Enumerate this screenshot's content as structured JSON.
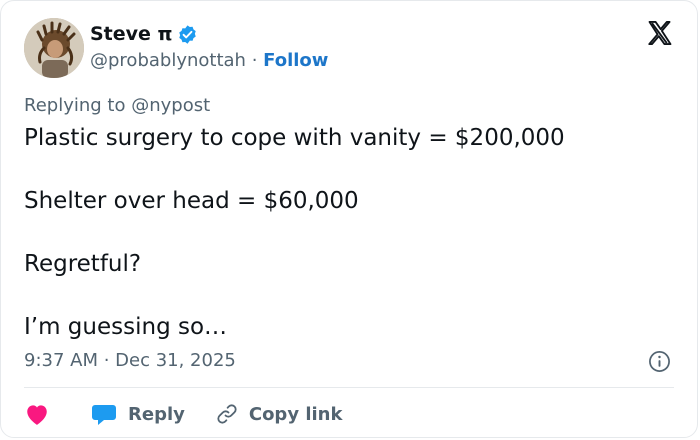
{
  "author": {
    "display_name": "Steve π",
    "handle": "@probablynottah",
    "separator": "·",
    "follow_label": "Follow",
    "verified": true
  },
  "reply_context": {
    "prefix": "Replying to",
    "mention": "@nypost"
  },
  "tweet": {
    "lines": [
      "Plastic surgery to cope with vanity = $200,000",
      "Shelter over head = $60,000",
      "Regretful?",
      "I’m guessing so…"
    ],
    "timestamp": "9:37 AM · Dec 31, 2025"
  },
  "actions": {
    "like_icon": "heart-icon",
    "reply_label": "Reply",
    "copy_link_label": "Copy link"
  },
  "colors": {
    "text": "#0f1419",
    "secondary": "#536471",
    "link": "#1d76c9",
    "verified": "#1d9bf0",
    "heart": "#f91880",
    "reply_bubble": "#1d9bf0",
    "divider": "#e6e9ec"
  },
  "icons": {
    "brand": "x-logo-icon",
    "info": "info-icon",
    "verified": "verified-badge-icon",
    "copy_link": "link-icon"
  }
}
